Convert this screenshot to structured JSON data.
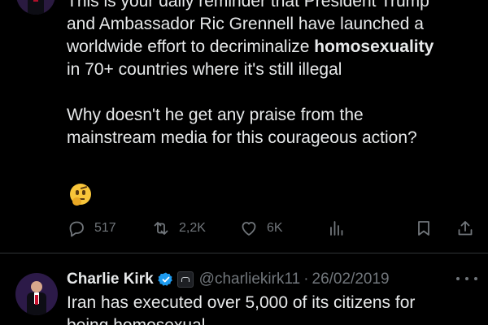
{
  "tweet1": {
    "lines": [
      "This is your daily reminder that President Trump",
      "and Ambassador Ric Grennell have launched a",
      "worldwide effort to decriminalize ",
      "homosexuality",
      "in 70+ countries where it's still illegal"
    ],
    "para2": [
      "Why doesn't he get any praise from the",
      "mainstream media for this courageous action?"
    ],
    "emoji": "thinking-face",
    "actions": {
      "replies": "517",
      "retweets": "2,2K",
      "likes": "6K"
    }
  },
  "tweet2": {
    "name": "Charlie Kirk",
    "handle": "@charliekirk11",
    "separator": "·",
    "date": "26/02/2019",
    "line1": "Iran has executed over 5,000 of its citizens for",
    "line2": "being homosexual"
  },
  "colors": {
    "background": "#000000",
    "text": "#e7e9ea",
    "muted": "#71767b",
    "verified": "#1d9bf0",
    "divider": "#2f3336"
  }
}
